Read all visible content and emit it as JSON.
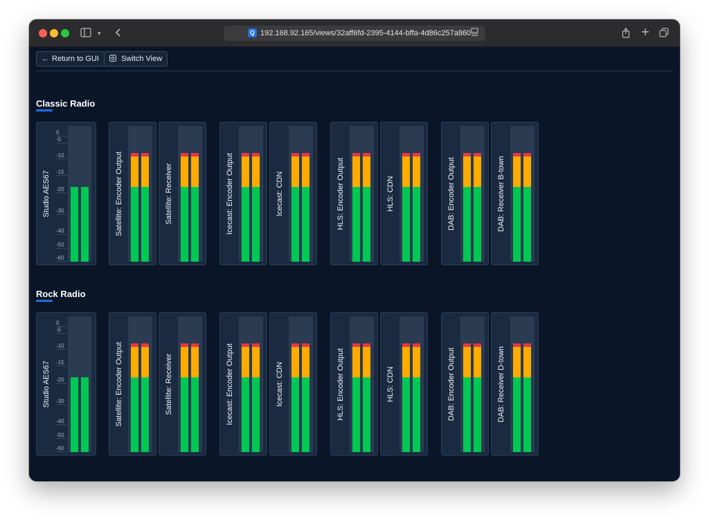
{
  "browser": {
    "url": "192.168.92.165/views/32aff6fd-2395-4144-bffa-4d86c257a860",
    "favicon_letter": "Q"
  },
  "toolbar": {
    "return_label": "Return to GUI",
    "switch_label": "Switch View"
  },
  "scale_ticks": [
    "0",
    "-5",
    "-10",
    "-15",
    "-20",
    "-30",
    "-40",
    "-50",
    "-60"
  ],
  "sections": [
    {
      "title": "Classic Radio",
      "channels": [
        {
          "label": "Studio AES67",
          "level": 0.55,
          "peak": false,
          "scale": true
        },
        {
          "label": "Satellite: Encoder Output",
          "level": 0.8,
          "peak": true
        },
        {
          "label": "Satellite: Receiver",
          "level": 0.8,
          "peak": true
        },
        {
          "label": "Icecast: Encoder Output",
          "level": 0.8,
          "peak": true
        },
        {
          "label": "Icecast: CDN",
          "level": 0.8,
          "peak": true
        },
        {
          "label": "HLS: Encoder Output",
          "level": 0.8,
          "peak": true
        },
        {
          "label": "HLS: CDN",
          "level": 0.8,
          "peak": true
        },
        {
          "label": "DAB: Encoder Output",
          "level": 0.8,
          "peak": true
        },
        {
          "label": "DAB: Receiver B-town",
          "level": 0.8,
          "peak": true
        }
      ]
    },
    {
      "title": "Rock Radio",
      "channels": [
        {
          "label": "Studio AES67",
          "level": 0.55,
          "peak": false,
          "scale": true
        },
        {
          "label": "Satellite: Encoder Output",
          "level": 0.8,
          "peak": true
        },
        {
          "label": "Satellite: Receiver",
          "level": 0.8,
          "peak": true
        },
        {
          "label": "Icecast: Encoder Output",
          "level": 0.8,
          "peak": true
        },
        {
          "label": "Icecast: CDN",
          "level": 0.8,
          "peak": true
        },
        {
          "label": "HLS: Encoder Output",
          "level": 0.8,
          "peak": true
        },
        {
          "label": "HLS: CDN",
          "level": 0.8,
          "peak": true
        },
        {
          "label": "DAB: Encoder Output",
          "level": 0.8,
          "peak": true
        },
        {
          "label": "DAB: Receiver D-town",
          "level": 0.8,
          "peak": true
        }
      ]
    }
  ],
  "colors": {
    "green": "#00c853",
    "yellow": "#ffab00",
    "red": "#e53945",
    "accent": "#1e6fe0",
    "background": "#0a1628"
  }
}
